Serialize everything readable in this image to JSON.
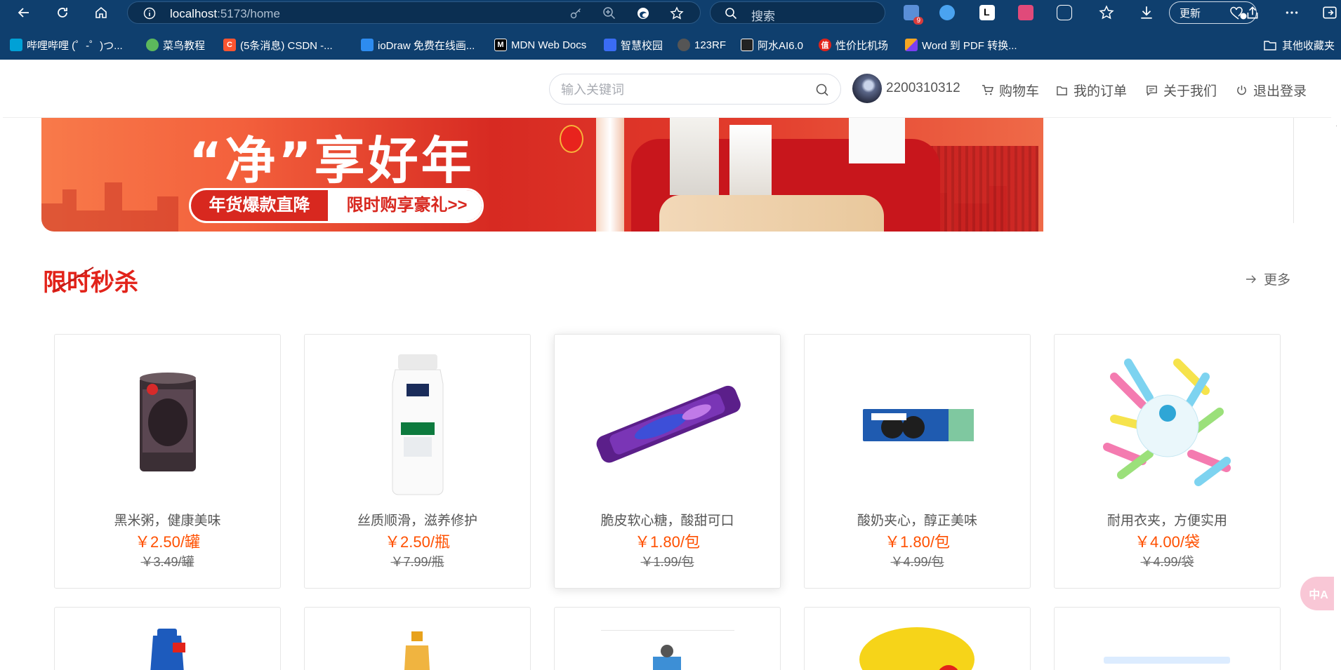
{
  "browser": {
    "url_host": "localhost",
    "url_path": ":5173/home",
    "search_placeholder": "搜索",
    "update_label": "更新",
    "ext_badge": "9",
    "bookmarks": [
      {
        "label": "哔哩哔哩 (゜-゜)つ...",
        "color": "#00a1d6",
        "icon": "bilibili-icon"
      },
      {
        "label": "菜鸟教程",
        "color": "#5cb85c",
        "icon": "runoob-icon"
      },
      {
        "label": "(5条消息) CSDN -...",
        "color": "#fc5531",
        "icon": "csdn-icon",
        "glyph": "C"
      },
      {
        "label": "ioDraw 免费在线画...",
        "color": "#2d8cf0",
        "icon": "iodraw-icon"
      },
      {
        "label": "MDN Web Docs",
        "color": "#000000",
        "icon": "mdn-icon",
        "glyph": "M"
      },
      {
        "label": "智慧校园",
        "color": "#3a6cf4",
        "icon": "campus-icon"
      },
      {
        "label": "123RF",
        "color": "#333333",
        "icon": "123rf-icon"
      },
      {
        "label": "阿水AI6.0",
        "color": "#222222",
        "icon": "ai-icon"
      },
      {
        "label": "性价比机场",
        "color": "#e2231a",
        "icon": "airport-icon",
        "glyph": "值"
      },
      {
        "label": "Word 到 PDF 转换...",
        "color": "#f5a623",
        "icon": "word-pdf-icon"
      }
    ],
    "other_bookmarks": "其他收藏夹"
  },
  "header": {
    "search_placeholder": "输入关键词",
    "username": "2200310312",
    "nav": {
      "cart": "购物车",
      "orders": "我的订单",
      "about": "关于我们",
      "logout": "退出登录"
    }
  },
  "banner": {
    "slogan": "“净”享好年",
    "pill_left": "年货爆款直降",
    "pill_right": "限时购享豪礼>>"
  },
  "section": {
    "title": "限时秒杀",
    "more": "更多"
  },
  "products": [
    {
      "name": "黑米粥，健康美味",
      "price": "￥2.50/罐",
      "original_price": "￥3.49/罐",
      "image": "black-rice-porridge-can"
    },
    {
      "name": "丝质顺滑，滋养修护",
      "price": "￥2.50/瓶",
      "original_price": "￥7.99/瓶",
      "image": "pantene-shampoo-bottle"
    },
    {
      "name": "脆皮软心糖，酸甜可口",
      "price": "￥1.80/包",
      "original_price": "￥1.99/包",
      "image": "purple-candy-stick"
    },
    {
      "name": "酸奶夹心，醇正美味",
      "price": "￥1.80/包",
      "original_price": "￥4.99/包",
      "image": "oreo-biscuit-box"
    },
    {
      "name": "耐用衣夹，方便实用",
      "price": "￥4.00/袋",
      "original_price": "￥4.99/袋",
      "image": "colorful-clothes-pegs"
    }
  ],
  "float_button": "中A"
}
